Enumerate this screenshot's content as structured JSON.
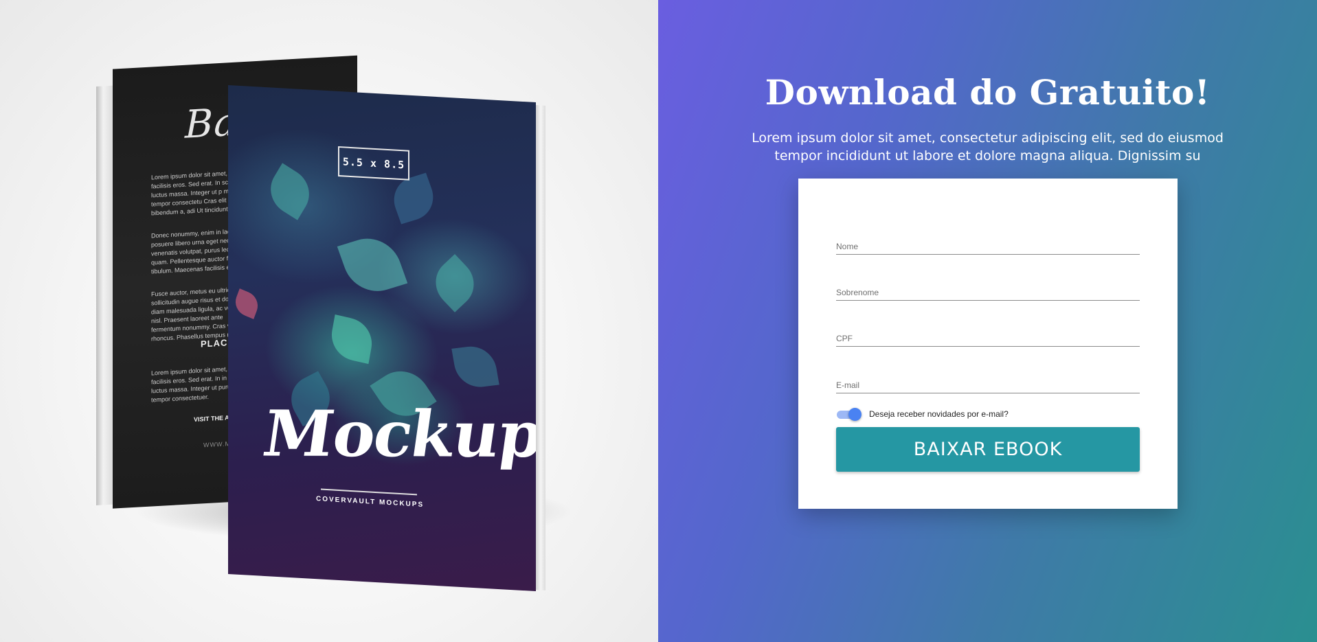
{
  "book_mockup": {
    "back_cover": {
      "title": "Back",
      "paragraph_1": "Lorem ipsum dolor sit amet, co varius facilisis eros. Sed erat. In scing luctus massa. Integer ut p mi eu justo tempor consectetu Cras elit lectus, bibendum a, adi Ut tincidunt tortor.",
      "paragraph_2": "Donec nonummy, enim in lacinia posuere libero urna eget neque venenatis volutpat, purus lectus quam. Pellentesque auctor fring tibulum. Maecenas facilisis elit s",
      "paragraph_3": "Fusce auctor, metus eu ultricies sollicitudin augue risus et dolor. A diam malesuada ligula, ac vesti ac nisl. Praesent laoreet ante fermentum nonummy. Cras vel rhoncus. Phasellus tempus mas",
      "place_label": "PLACE YOU",
      "paragraph_4": "Lorem ipsum dolor sit amet, co facilisis eros. Sed erat. In in velit luctus massa. Integer ut purus justo tempor consectetuer.",
      "visit_label": "VISIT THE AUTHORS WEBSITE AT:",
      "site": "WWW.MYSITE.COM"
    },
    "front_cover": {
      "size": "5.5 x 8.5",
      "title": "Mockup",
      "subtitle": "COVERVAULT MOCKUPS"
    }
  },
  "headline": "Download do Gratuito!",
  "subtext": "Lorem ipsum dolor sit amet, consectetur adipiscing elit, sed do eiusmod tempor incididunt ut labore et dolore magna aliqua. Dignissim su",
  "form": {
    "fields": [
      {
        "placeholder": "Nome",
        "value": ""
      },
      {
        "placeholder": "Sobrenome",
        "value": ""
      },
      {
        "placeholder": "CPF",
        "value": ""
      },
      {
        "placeholder": "E-mail",
        "value": ""
      }
    ],
    "newsletter_toggle": {
      "label": "Deseja receber novidades por e-mail?",
      "checked": true
    },
    "submit_label": "BAIXAR EBOOK"
  },
  "colors": {
    "gradient_start": "#6a5ee0",
    "gradient_end": "#2a8f90",
    "button": "#2597a3",
    "toggle_on": "#4a82f2"
  }
}
